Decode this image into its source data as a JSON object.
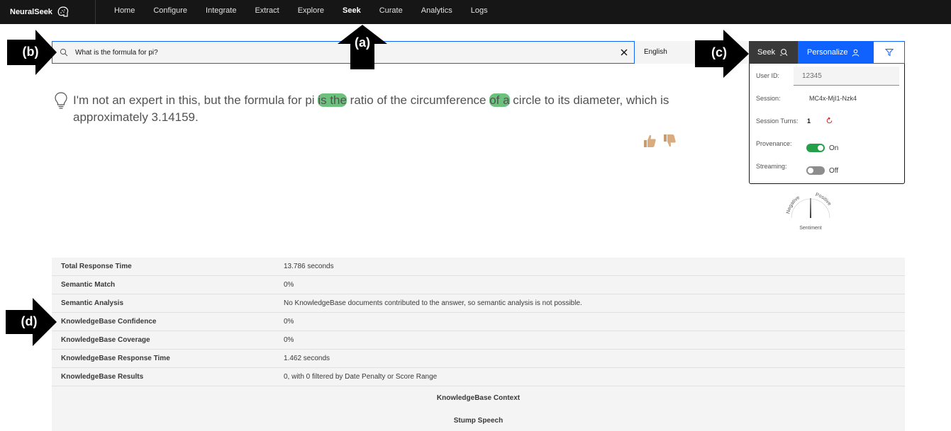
{
  "nav": {
    "brand": "NeuralSeek",
    "items": [
      "Home",
      "Configure",
      "Integrate",
      "Extract",
      "Explore",
      "Seek",
      "Curate",
      "Analytics",
      "Logs"
    ],
    "active": "Seek"
  },
  "search": {
    "value": "What is the formula for pi?",
    "language": "English"
  },
  "buttons": {
    "seek": "Seek",
    "personalize": "Personalize"
  },
  "panel": {
    "user_id_label": "User ID:",
    "user_id_value": "12345",
    "session_label": "Session:",
    "session_value": "MC4x-MjI1-Nzk4",
    "turns_label": "Session Turns:",
    "turns_value": "1",
    "provenance_label": "Provenance:",
    "provenance_state": "On",
    "streaming_label": "Streaming:",
    "streaming_state": "Off"
  },
  "sentiment": {
    "negative": "Negative",
    "positive": "Positive",
    "label": "Sentiment"
  },
  "answer": {
    "part1": "I'm not an expert in this, but the formula for pi ",
    "hl1": "is the",
    "part2": " ratio of the circumference ",
    "hl2": "of a",
    "part3": " circle to its diameter, which is approximately 3.14159."
  },
  "stats": {
    "rows": [
      {
        "label": "Total Response Time",
        "value": "13.786 seconds"
      },
      {
        "label": "Semantic Match",
        "value": "0%"
      },
      {
        "label": "Semantic Analysis",
        "value": "No KnowledgeBase documents contributed to the answer, so semantic analysis is not possible."
      },
      {
        "label": "KnowledgeBase Confidence",
        "value": "0%"
      },
      {
        "label": "KnowledgeBase Coverage",
        "value": "0%"
      },
      {
        "label": "KnowledgeBase Response Time",
        "value": "1.462 seconds"
      },
      {
        "label": "KnowledgeBase Results",
        "value": "0, with 0 filtered by Date Penalty or Score Range"
      }
    ],
    "context_heading": "KnowledgeBase Context",
    "stump_heading": "Stump Speech"
  },
  "callouts": {
    "a": "(a)",
    "b": "(b)",
    "c": "(c)",
    "d": "(d)"
  }
}
